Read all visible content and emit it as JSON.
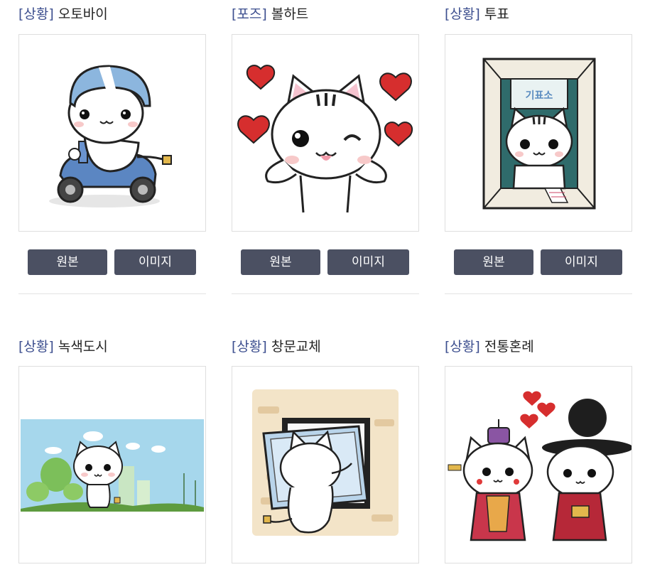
{
  "cards": [
    {
      "category": "[상황]",
      "name": "오토바이",
      "original_label": "원본",
      "image_label": "이미지"
    },
    {
      "category": "[포즈]",
      "name": "볼하트",
      "original_label": "원본",
      "image_label": "이미지"
    },
    {
      "category": "[상황]",
      "name": "투표",
      "original_label": "원본",
      "image_label": "이미지",
      "sign": "기표소"
    },
    {
      "category": "[상황]",
      "name": "녹색도시"
    },
    {
      "category": "[상황]",
      "name": "창문교체"
    },
    {
      "category": "[상황]",
      "name": "전통혼례"
    }
  ],
  "colors": {
    "category": "#3d4f8f",
    "button_bg": "#4b5062",
    "button_text": "#ffffff",
    "frame_border": "#dedede"
  }
}
